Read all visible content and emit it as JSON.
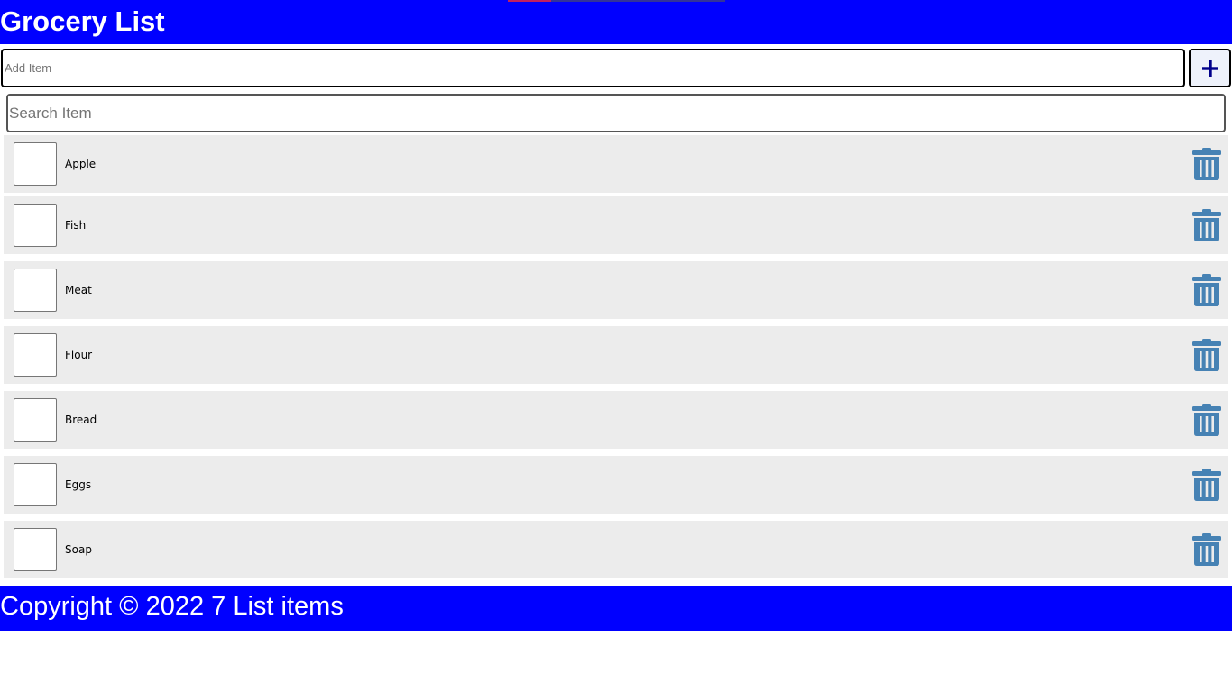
{
  "header": {
    "title": "Grocery List"
  },
  "add_form": {
    "placeholder": "Add Item",
    "value": "",
    "button_icon": "plus-icon"
  },
  "search": {
    "placeholder": "Search Item",
    "value": ""
  },
  "items": [
    {
      "label": "Apple",
      "checked": false
    },
    {
      "label": "Fish",
      "checked": false
    },
    {
      "label": "Meat",
      "checked": false
    },
    {
      "label": "Flour",
      "checked": false
    },
    {
      "label": "Bread",
      "checked": false
    },
    {
      "label": "Eggs",
      "checked": false
    },
    {
      "label": "Soap",
      "checked": false
    }
  ],
  "item_delete_icon": "trash-icon",
  "footer": {
    "text": "Copyright © 2022 7 List items"
  },
  "colors": {
    "bar": "#0000ff",
    "row": "#ececec",
    "trash": "#4682b4",
    "plus": "#00008b"
  }
}
